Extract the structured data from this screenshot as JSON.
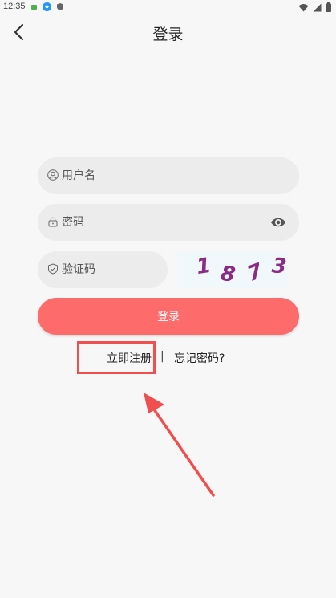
{
  "status_bar": {
    "time": "12:35"
  },
  "header": {
    "title": "登录"
  },
  "form": {
    "username_placeholder": "用户名",
    "password_placeholder": "密码",
    "captcha_placeholder": "验证码",
    "captcha_digits": [
      "1",
      "8",
      "7",
      "3"
    ]
  },
  "login_button": {
    "label": "登录"
  },
  "links": {
    "register": "立即注册",
    "separator": "|",
    "forgot": "忘记密码?"
  },
  "colors": {
    "accent": "#fd6b6b",
    "highlight": "#f04f4f",
    "captcha_text": "#8a2b88"
  }
}
